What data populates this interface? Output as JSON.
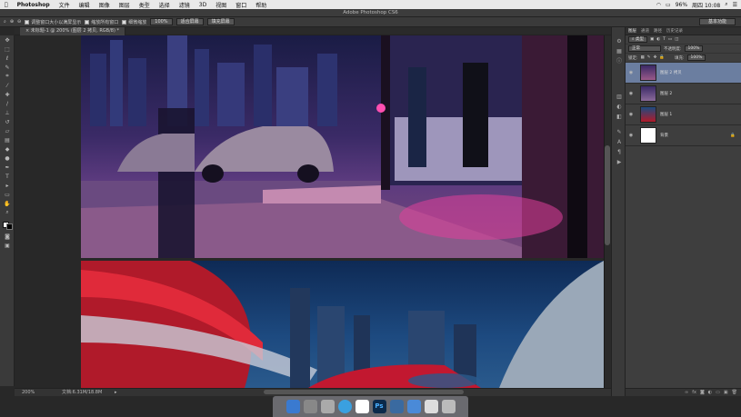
{
  "menubar": {
    "apple": "",
    "app": "Photoshop",
    "items": [
      "文件",
      "编辑",
      "图像",
      "图层",
      "类型",
      "选择",
      "滤镜",
      "3D",
      "视图",
      "窗口",
      "帮助"
    ],
    "battery": "96%",
    "datetime": "周四 10:08"
  },
  "window": {
    "title": "Adobe Photoshop CS6"
  },
  "options": {
    "cb1": "调整窗口大小以满屏显示",
    "cb2": "缩放所有窗口",
    "cb3": "细微缩放",
    "btn1": "100%",
    "btn2": "适合屏幕",
    "btn3": "填充屏幕",
    "workspace": "基本功能"
  },
  "document": {
    "tab": "未标题-1 @ 200% (图层 2 拷贝, RGB/8) *"
  },
  "status": {
    "zoom": "200%",
    "doc": "文档:6.31M/18.8M"
  },
  "panel": {
    "tabs": [
      "图层",
      "通道",
      "路径",
      "历史记录"
    ],
    "kind": "类型",
    "blend": "正常",
    "opacity_label": "不透明度:",
    "opacity": "100%",
    "lock_label": "锁定:",
    "fill_label": "填充:",
    "fill": "100%",
    "layers": [
      {
        "name": "图层 2 拷贝",
        "selected": true
      },
      {
        "name": "图层 2",
        "selected": false
      },
      {
        "name": "图层 1",
        "selected": false
      },
      {
        "name": "背景",
        "selected": false
      }
    ]
  },
  "colors": {
    "accent": "#6b7ea0",
    "magenta": "#e0409a"
  }
}
